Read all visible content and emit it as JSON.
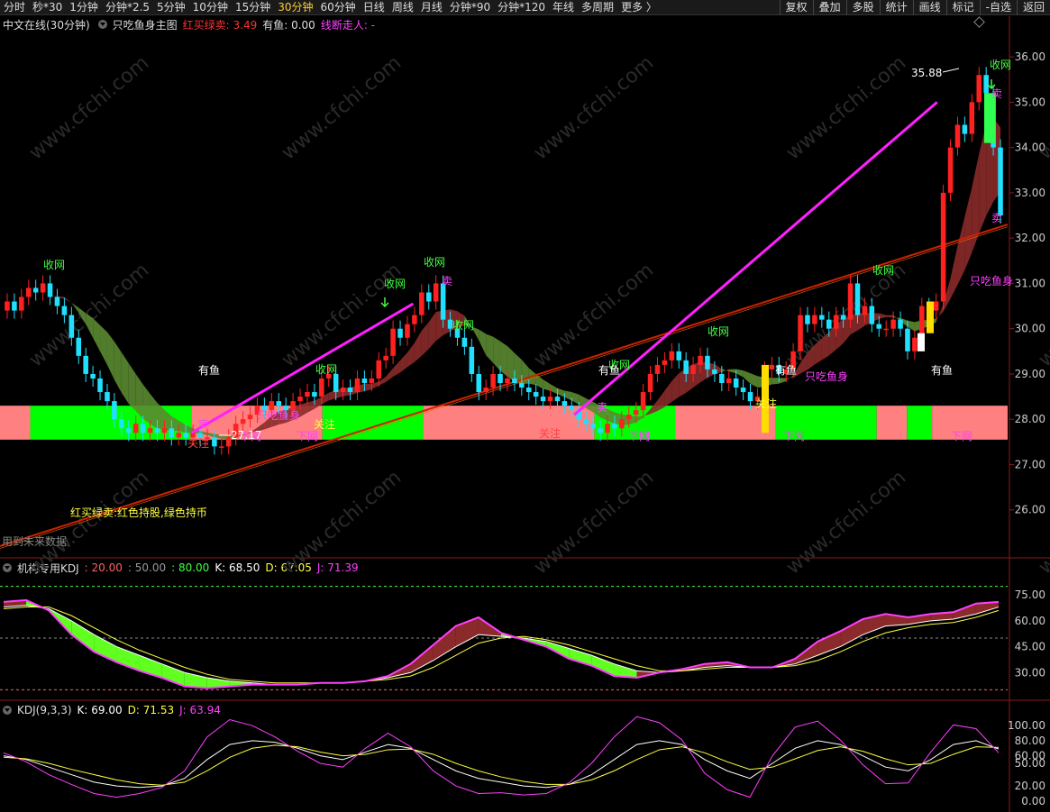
{
  "toolbar": {
    "items": [
      "分时",
      "秒*30",
      "1分钟",
      "分钟*2.5",
      "5分钟",
      "10分钟",
      "15分钟",
      "30分钟",
      "60分钟",
      "日线",
      "周线",
      "月线",
      "分钟*90",
      "分钟*120",
      "年线",
      "多周期",
      "更多 〉"
    ],
    "active": "30分钟",
    "right_items": [
      "复权",
      "叠加",
      "多股",
      "统计",
      "画线",
      "标记",
      "-自选",
      "返回"
    ]
  },
  "main_header": {
    "name": "中文在线(30分钟)",
    "indicator": "只吃鱼身主图",
    "signal_label": "红买绿卖: 3.49",
    "fish_label": "有鱼: 0.00",
    "line_label": "线断走人: -"
  },
  "kdj1_header": {
    "name": "机构专用KDJ",
    "v1": ": 20.00",
    "v2": ": 50.00",
    "v3": ": 80.00",
    "k": "K: 68.50",
    "d": "D: 67.05",
    "j": "J: 71.39"
  },
  "kdj2_header": {
    "name": "KDJ(9,3,3)",
    "k": "K: 69.00",
    "d": "D: 71.53",
    "j": "J: 63.94"
  },
  "annotations": {
    "max_price": "35.88",
    "min_price": "27.17",
    "legend_text": "红买绿卖:红色持股,绿色持币",
    "future_text": "用到未来数据",
    "watermark": "www.cfchi.com"
  },
  "colors": {
    "up": "#ff2020",
    "down": "#20e0ff",
    "band_green": "#00ff00",
    "band_red": "#ff8080",
    "trend": "#cc2200",
    "magenta": "#ff20ff",
    "k_line": "#ffffff",
    "d_line": "#ffff40",
    "j_line": "#ff40ff"
  },
  "chart_data": [
    {
      "type": "candlestick",
      "ylim": [
        25.0,
        36.5
      ],
      "yticks": [
        "36.00",
        "35.00",
        "34.00",
        "33.00",
        "32.00",
        "31.00",
        "30.00",
        "29.00",
        "28.00",
        "27.00",
        "26.00"
      ],
      "ytick_values": [
        36,
        35,
        34,
        33,
        32,
        31,
        30,
        29,
        28,
        27,
        26
      ],
      "close": [
        30.6,
        30.4,
        30.7,
        30.9,
        30.8,
        31.0,
        30.7,
        30.5,
        30.3,
        29.8,
        29.4,
        29.0,
        28.9,
        28.6,
        28.4,
        28.0,
        27.8,
        27.7,
        27.9,
        27.7,
        27.8,
        27.7,
        27.8,
        27.6,
        27.7,
        27.6,
        27.7,
        27.6,
        27.6,
        27.4,
        27.4,
        27.6,
        27.9,
        28.0,
        28.1,
        28.3,
        28.2,
        28.4,
        28.3,
        28.2,
        28.4,
        28.5,
        28.6,
        28.5,
        28.9,
        29.0,
        28.6,
        28.7,
        28.6,
        28.9,
        28.8,
        28.9,
        29.3,
        29.4,
        30.0,
        29.8,
        30.1,
        30.3,
        30.8,
        30.6,
        31.0,
        30.2,
        30.0,
        29.8,
        29.6,
        29.0,
        28.6,
        28.7,
        29.0,
        28.8,
        28.9,
        28.8,
        28.7,
        28.6,
        28.5,
        28.4,
        28.5,
        28.4,
        28.3,
        28.2,
        28.0,
        27.9,
        27.8,
        27.7,
        27.9,
        27.8,
        28.0,
        28.1,
        28.2,
        28.6,
        29.0,
        29.2,
        29.3,
        29.5,
        29.3,
        29.0,
        29.2,
        29.4,
        29.1,
        29.0,
        28.8,
        28.9,
        28.7,
        28.6,
        28.4,
        28.5,
        29.1,
        29.2,
        29.0,
        29.1,
        29.5,
        30.3,
        30.1,
        30.3,
        30.2,
        30.0,
        30.3,
        30.2,
        31.0,
        30.3,
        30.5,
        30.1,
        30.0,
        30.0,
        30.2,
        30.0,
        29.5,
        29.8,
        30.5,
        30.4,
        30.6,
        33.0,
        34.0,
        34.5,
        34.3,
        35.0,
        35.6,
        35.2,
        34.0,
        32.5
      ],
      "max_label": 35.88,
      "min_label": 27.17
    },
    {
      "type": "line",
      "title": "机构专用KDJ",
      "ylim": [
        20,
        80
      ],
      "yticks": [
        "75.00",
        "60.00",
        "45.00",
        "30.00"
      ],
      "ytick_values": [
        75,
        60,
        45,
        30
      ],
      "hlines": [
        20,
        50,
        80
      ],
      "series": [
        {
          "name": "K",
          "values": [
            68,
            69,
            67,
            60,
            52,
            45,
            40,
            35,
            30,
            27,
            25,
            24,
            23,
            23,
            24,
            24,
            25,
            27,
            30,
            37,
            45,
            52,
            51,
            50,
            48,
            44,
            40,
            35,
            31,
            30,
            31,
            33,
            34,
            33,
            33,
            35,
            40,
            45,
            52,
            57,
            58,
            60,
            61,
            64,
            68
          ]
        },
        {
          "name": "D",
          "values": [
            67,
            68,
            68,
            63,
            56,
            49,
            43,
            38,
            33,
            29,
            26,
            25,
            24,
            24,
            24,
            24,
            25,
            26,
            28,
            33,
            40,
            47,
            50,
            51,
            49,
            46,
            42,
            38,
            34,
            31,
            31,
            32,
            33,
            33,
            33,
            34,
            37,
            42,
            48,
            53,
            56,
            58,
            59,
            62,
            66
          ]
        },
        {
          "name": "J",
          "values": [
            71,
            72,
            66,
            52,
            42,
            36,
            31,
            27,
            22,
            21,
            22,
            23,
            23,
            23,
            24,
            24,
            25,
            28,
            35,
            46,
            57,
            62,
            53,
            49,
            45,
            38,
            34,
            28,
            27,
            30,
            32,
            35,
            36,
            33,
            33,
            38,
            48,
            54,
            61,
            64,
            62,
            64,
            65,
            70,
            71
          ]
        }
      ]
    },
    {
      "type": "line",
      "title": "KDJ(9,3,3)",
      "ylim": [
        0,
        100
      ],
      "yticks": [
        "100.00",
        "80.00",
        "60.00",
        "50.00",
        "20.00",
        "0.00"
      ],
      "ytick_values": [
        100,
        80,
        60,
        50,
        20,
        0
      ],
      "series": [
        {
          "name": "K",
          "values": [
            60,
            55,
            45,
            35,
            25,
            20,
            18,
            20,
            30,
            55,
            75,
            80,
            78,
            70,
            60,
            55,
            65,
            75,
            70,
            55,
            40,
            30,
            25,
            20,
            18,
            22,
            35,
            55,
            75,
            80,
            75,
            55,
            40,
            30,
            50,
            70,
            80,
            75,
            60,
            45,
            40,
            55,
            75,
            80,
            69
          ]
        },
        {
          "name": "D",
          "values": [
            58,
            56,
            50,
            42,
            35,
            28,
            23,
            21,
            25,
            40,
            58,
            70,
            74,
            72,
            65,
            60,
            62,
            68,
            69,
            62,
            50,
            40,
            32,
            26,
            22,
            22,
            28,
            40,
            55,
            68,
            72,
            64,
            52,
            42,
            45,
            56,
            67,
            72,
            66,
            56,
            48,
            50,
            62,
            72,
            71
          ]
        },
        {
          "name": "J",
          "values": [
            64,
            52,
            35,
            22,
            10,
            5,
            10,
            18,
            40,
            85,
            108,
            100,
            85,
            66,
            50,
            45,
            70,
            90,
            72,
            40,
            20,
            10,
            11,
            8,
            10,
            24,
            50,
            85,
            112,
            104,
            81,
            37,
            15,
            5,
            60,
            98,
            106,
            81,
            48,
            23,
            24,
            65,
            101,
            96,
            64
          ]
        }
      ]
    }
  ]
}
